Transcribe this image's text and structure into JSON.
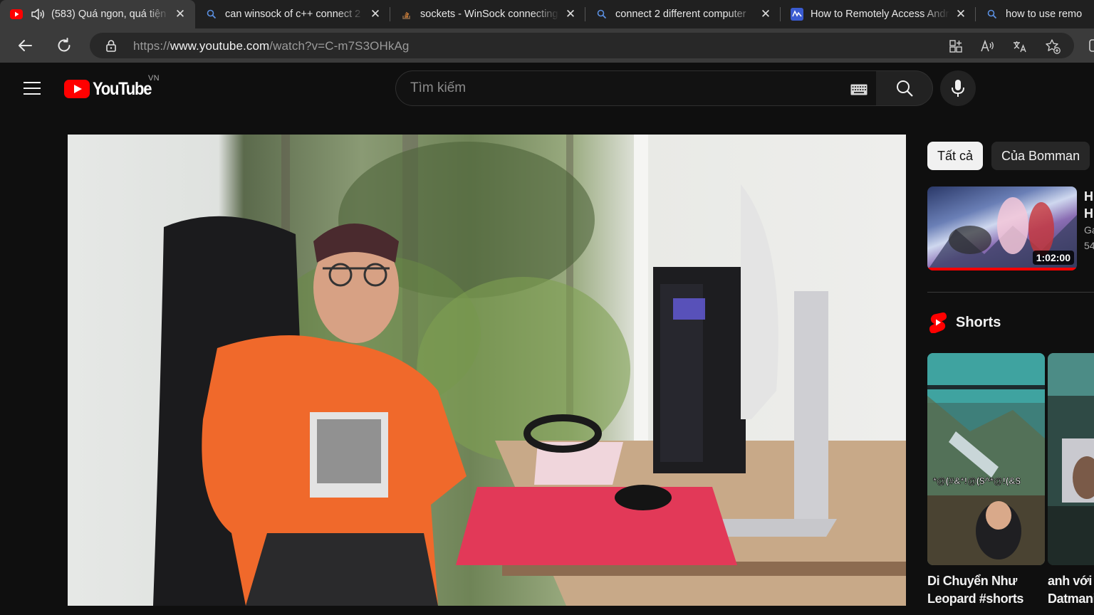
{
  "browser": {
    "tabs": [
      {
        "title": "(583) Quá ngon, quá tiện",
        "favicon": "youtube-icon",
        "active": true,
        "audio": true
      },
      {
        "title": "can winsock of c++ connect 2",
        "favicon": "search-icon",
        "active": false
      },
      {
        "title": "sockets - WinSock connecting",
        "favicon": "stackoverflow-icon",
        "active": false
      },
      {
        "title": "connect 2 different computer",
        "favicon": "search-icon",
        "active": false
      },
      {
        "title": "How to Remotely Access Andr",
        "favicon": "app-icon",
        "active": false
      },
      {
        "title": "how to use remo",
        "favicon": "search-icon",
        "active": false
      }
    ],
    "address": {
      "scheme": "https://",
      "host": "www.youtube.com",
      "path": "/watch?v=C-m7S3OHkAg"
    }
  },
  "youtube": {
    "logo_text": "YouTube",
    "country_code": "VN",
    "search_placeholder": "Tìm kiếm",
    "brand_red": "#ff0000"
  },
  "sidebar": {
    "chips": [
      {
        "label": "Tất cả",
        "active": true
      },
      {
        "label": "Của Bomman",
        "active": false
      }
    ],
    "recommendation": {
      "title_line1": "H",
      "title_line2": "H",
      "channel": "Ga",
      "views": "54",
      "duration": "1:02:00",
      "watched_fraction": 1.0
    },
    "shorts_label": "Shorts",
    "shorts": [
      {
        "title_line1": "Di Chuyển Như",
        "title_line2": "Leopard #shorts",
        "overlay_text": "*@(#&*!@($^*@!(&$"
      },
      {
        "title_line1": "anh với",
        "title_line2": "Datmani"
      }
    ]
  }
}
